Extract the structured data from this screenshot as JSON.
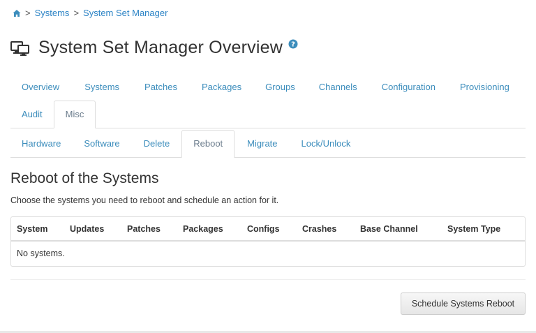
{
  "breadcrumb": {
    "home_icon": "home-icon",
    "separator": ">",
    "items": [
      "Systems",
      "System Set Manager"
    ]
  },
  "page": {
    "title": "System Set Manager Overview",
    "title_icon": "desktop-icon",
    "help_icon": "question-circle-icon"
  },
  "tabs_primary": [
    "Overview",
    "Systems",
    "Patches",
    "Packages",
    "Groups",
    "Channels",
    "Configuration",
    "Provisioning",
    "Audit",
    "Misc"
  ],
  "tabs_primary_active": "Misc",
  "tabs_secondary": [
    "Hardware",
    "Software",
    "Delete",
    "Reboot",
    "Migrate",
    "Lock/Unlock"
  ],
  "tabs_secondary_active": "Reboot",
  "section": {
    "title": "Reboot of the Systems",
    "description": "Choose the systems you need to reboot and schedule an action for it."
  },
  "table": {
    "columns": [
      "System",
      "Updates",
      "Patches",
      "Packages",
      "Configs",
      "Crashes",
      "Base Channel",
      "System Type"
    ],
    "empty_message": "No systems."
  },
  "actions": {
    "schedule_button": "Schedule Systems Reboot"
  },
  "colors": {
    "link": "#3c8dbc",
    "active_tab_text": "#6b7c8c",
    "border": "#dddddd"
  }
}
